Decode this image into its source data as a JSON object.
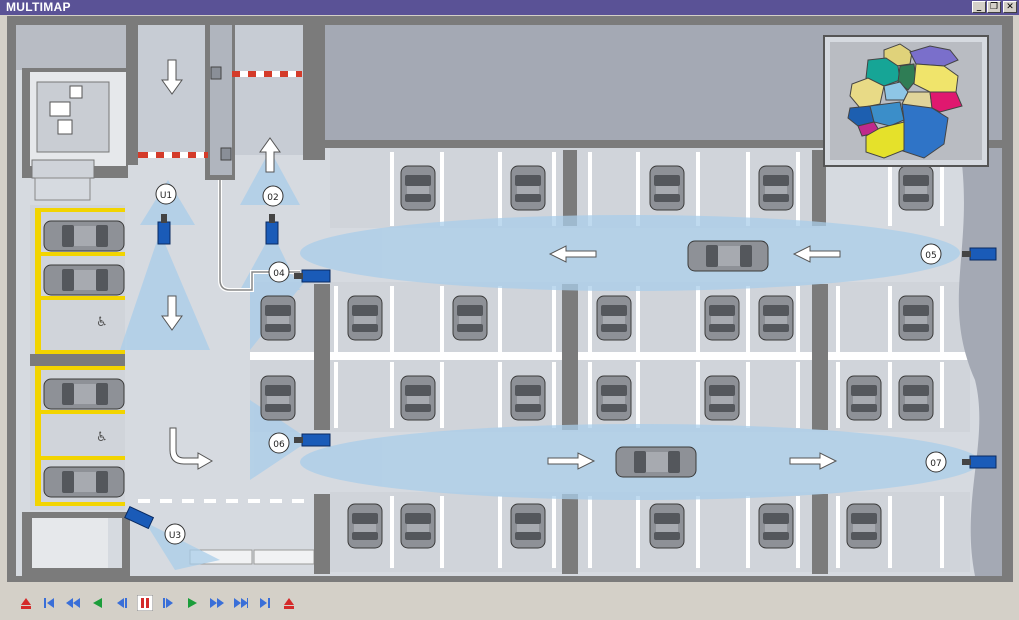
{
  "window": {
    "title": "MULTIMAP",
    "buttons": {
      "minimize": "_",
      "restore": "❐",
      "close": "✕"
    }
  },
  "cameras": [
    {
      "id": "U1"
    },
    {
      "id": "02"
    },
    {
      "id": "04"
    },
    {
      "id": "05"
    },
    {
      "id": "06"
    },
    {
      "id": "07"
    },
    {
      "id": "U3"
    }
  ],
  "colors": {
    "titlebar": "#5a5296",
    "floor": "#dcdfe3",
    "bay_floor": "#c8ccd4",
    "wall": "#7b7b7b",
    "pillar": "#6e6e6e",
    "camera": "#1a5bb8",
    "camera_beam": "#a9cdea",
    "barrier_red": "#d43b2a",
    "handicap_yellow": "#f2d400",
    "car": "#8a8d93"
  },
  "playback_controls": [
    {
      "name": "eject-icon",
      "glyph": "eject"
    },
    {
      "name": "skip-to-start-icon",
      "glyph": "start"
    },
    {
      "name": "fast-rewind-icon",
      "glyph": "frew"
    },
    {
      "name": "play-reverse-icon",
      "glyph": "rplay"
    },
    {
      "name": "step-back-icon",
      "glyph": "stepb"
    },
    {
      "name": "pause-icon",
      "glyph": "pause"
    },
    {
      "name": "step-forward-icon",
      "glyph": "stepf"
    },
    {
      "name": "play-icon",
      "glyph": "play"
    },
    {
      "name": "fast-forward-icon",
      "glyph": "ffwd"
    },
    {
      "name": "faster-forward-icon",
      "glyph": "ffwd2"
    },
    {
      "name": "skip-to-end-icon",
      "glyph": "end"
    },
    {
      "name": "record-icon",
      "glyph": "rec"
    }
  ],
  "minimap": {
    "region": "germany-states-map"
  }
}
